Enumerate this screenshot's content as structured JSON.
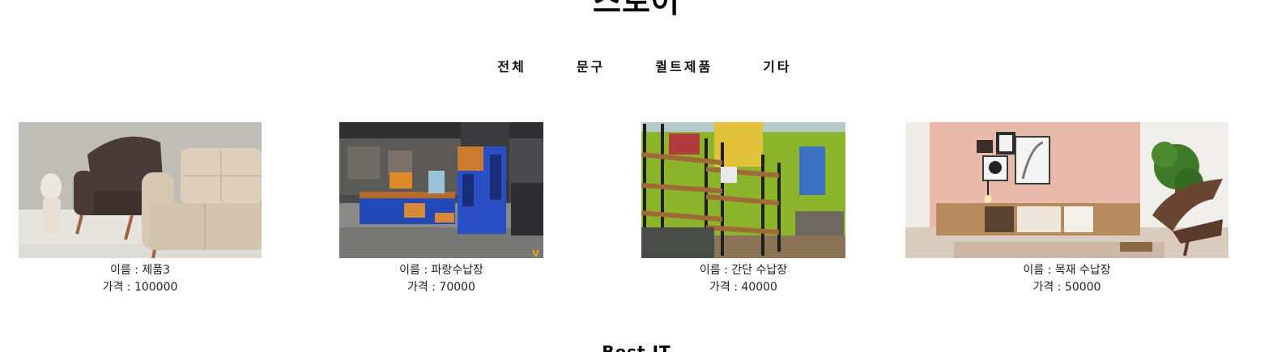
{
  "page": {
    "title": "스토어"
  },
  "categories": [
    {
      "label": "전체"
    },
    {
      "label": "문구"
    },
    {
      "label": "퀼트제품"
    },
    {
      "label": "기타"
    }
  ],
  "products": [
    {
      "name": "이름 : 제품3",
      "price": "가격 : 100000",
      "image_desc": "sofa-and-armchair-photo"
    },
    {
      "name": "이름 : 파랑수납장",
      "price": "가격 : 70000",
      "image_desc": "blue-storage-cabinet-photo"
    },
    {
      "name": "이름 : 간단 수납장",
      "price": "가격 : 40000",
      "image_desc": "metal-shelf-storage-photo"
    },
    {
      "name": "이름 : 목재 수납장",
      "price": "가격 : 50000",
      "image_desc": "wooden-tv-cabinet-photo"
    }
  ],
  "section": {
    "title": "Best IT"
  }
}
